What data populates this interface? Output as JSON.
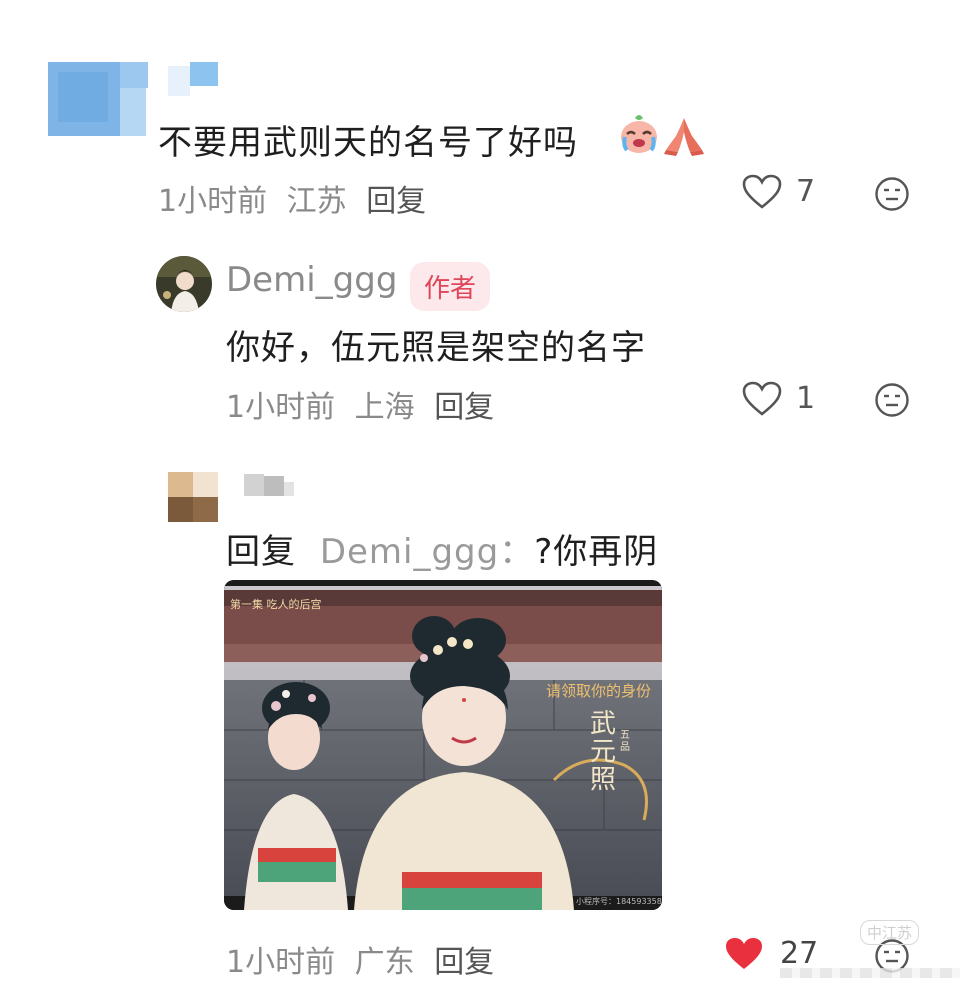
{
  "comment_1": {
    "text": "不要用武则天的名号了好吗",
    "emoji": [
      "crying-face-emoji",
      "praying-hands-emoji"
    ],
    "time": "1小时前",
    "location": "江苏",
    "reply_label": "回复",
    "likes": "7"
  },
  "comment_2": {
    "username": "Demi_ggg",
    "badge": "作者",
    "text": "你好，伍元照是架空的名字",
    "time": "1小时前",
    "location": "上海",
    "reply_label": "回复",
    "likes": "1"
  },
  "comment_3": {
    "reply_prefix": "回复",
    "reply_target": "Demi_ggg：",
    "text": "?你再阴",
    "time": "1小时前",
    "location": "广东",
    "reply_label": "回复",
    "likes": "27",
    "liked": true,
    "image": {
      "caption_top": "第一集 吃人的后宫",
      "caption_banner": "请领取你的身份",
      "name_vertical": "武元照",
      "rank": "五品",
      "id_line": "小程序号：184593358"
    }
  },
  "colors": {
    "liked_heart": "#e8303f",
    "badge_bg": "#fde9ec",
    "badge_text": "#e0455a",
    "meta_text": "#8a8a8a"
  },
  "watermark": "中江苏"
}
